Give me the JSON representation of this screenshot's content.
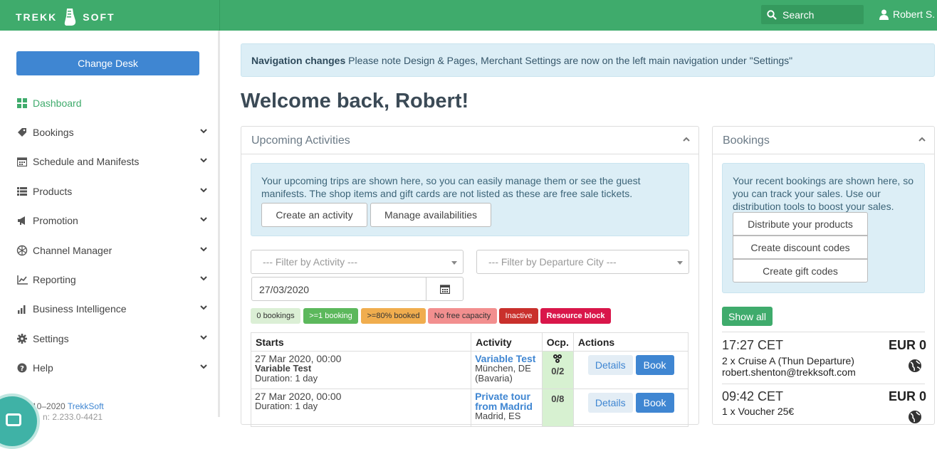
{
  "header": {
    "brand_left": "TREKK",
    "brand_right": "SOFT",
    "search_label": "Search",
    "user_name": "Robert S."
  },
  "sidebar": {
    "change_desk": "Change Desk",
    "items": [
      {
        "label": "Dashboard",
        "icon": "dashboard-icon",
        "active": true
      },
      {
        "label": "Bookings",
        "icon": "tag-icon"
      },
      {
        "label": "Schedule and Manifests",
        "icon": "calendar-icon"
      },
      {
        "label": "Products",
        "icon": "list-icon"
      },
      {
        "label": "Promotion",
        "icon": "megaphone-icon"
      },
      {
        "label": "Channel Manager",
        "icon": "network-icon"
      },
      {
        "label": "Reporting",
        "icon": "line-chart-icon"
      },
      {
        "label": "Business Intelligence",
        "icon": "bar-chart-icon"
      },
      {
        "label": "Settings",
        "icon": "gear-icon"
      },
      {
        "label": "Help",
        "icon": "question-icon"
      }
    ],
    "footer_copy_prefix": "10–2020",
    "footer_copy_link": "TrekkSoft",
    "footer_version": "n: 2.233.0-4421"
  },
  "notice": {
    "title": "Navigation changes",
    "text": "Please note Design & Pages, Merchant Settings are now on the left main navigation under \"Settings\""
  },
  "welcome": "Welcome back, Robert!",
  "upcoming": {
    "title": "Upcoming Activities",
    "info": "Your upcoming trips are shown here, so you can easily manage them or see the guest manifests. The shop items and gift cards are not listed as these are free sale tickets.",
    "create_activity": "Create an activity",
    "manage_availabilities": "Manage availabilities",
    "filter_activity": "--- Filter by Activity ---",
    "filter_city": "--- Filter by Departure City ---",
    "date": "27/03/2020",
    "legend": [
      {
        "label": "0 bookings",
        "bg": "#dbefd5",
        "fg": "#333"
      },
      {
        "label": ">=1 booking",
        "bg": "#5cb85c",
        "fg": "#fff"
      },
      {
        "label": ">=80% booked",
        "bg": "#f0ad4e",
        "fg": "#333"
      },
      {
        "label": "No free capacity",
        "bg": "#f28f8f",
        "fg": "#333"
      },
      {
        "label": "Inactive",
        "bg": "#c9302c",
        "fg": "#fff"
      },
      {
        "label": "Resource block",
        "bg": "#d9164a",
        "fg": "#fff"
      }
    ],
    "columns": [
      "Starts",
      "Activity",
      "Ocp.",
      "Actions"
    ],
    "rows": [
      {
        "start": "27 Mar 2020, 00:00",
        "name": "Variable Test",
        "duration": "Duration: 1 day",
        "activity": "Variable Test",
        "location": "München, DE (Bavaria)",
        "ocp": "0/2",
        "details": "Details",
        "book": "Book"
      },
      {
        "start": "27 Mar 2020, 00:00",
        "name": "",
        "duration": "Duration: 1 day",
        "activity": "Private tour from Madrid",
        "location": "Madrid, ES",
        "ocp": "0/8",
        "details": "Details",
        "book": "Book"
      }
    ]
  },
  "bookings": {
    "title": "Bookings",
    "info": "Your recent bookings are shown here, so you can track your sales. Use our distribution tools to boost your sales.",
    "buttons": [
      "Distribute your products",
      "Create discount codes",
      "Create gift codes"
    ],
    "show_all": "Show all",
    "items": [
      {
        "time": "17:27 CET",
        "amount": "EUR 0",
        "desc": "2 x Cruise A (Thun Departure)",
        "email": "robert.shenton@trekksoft.com"
      },
      {
        "time": "09:42 CET",
        "amount": "EUR 0",
        "desc": "1 x Voucher 25€",
        "email": ""
      }
    ]
  }
}
